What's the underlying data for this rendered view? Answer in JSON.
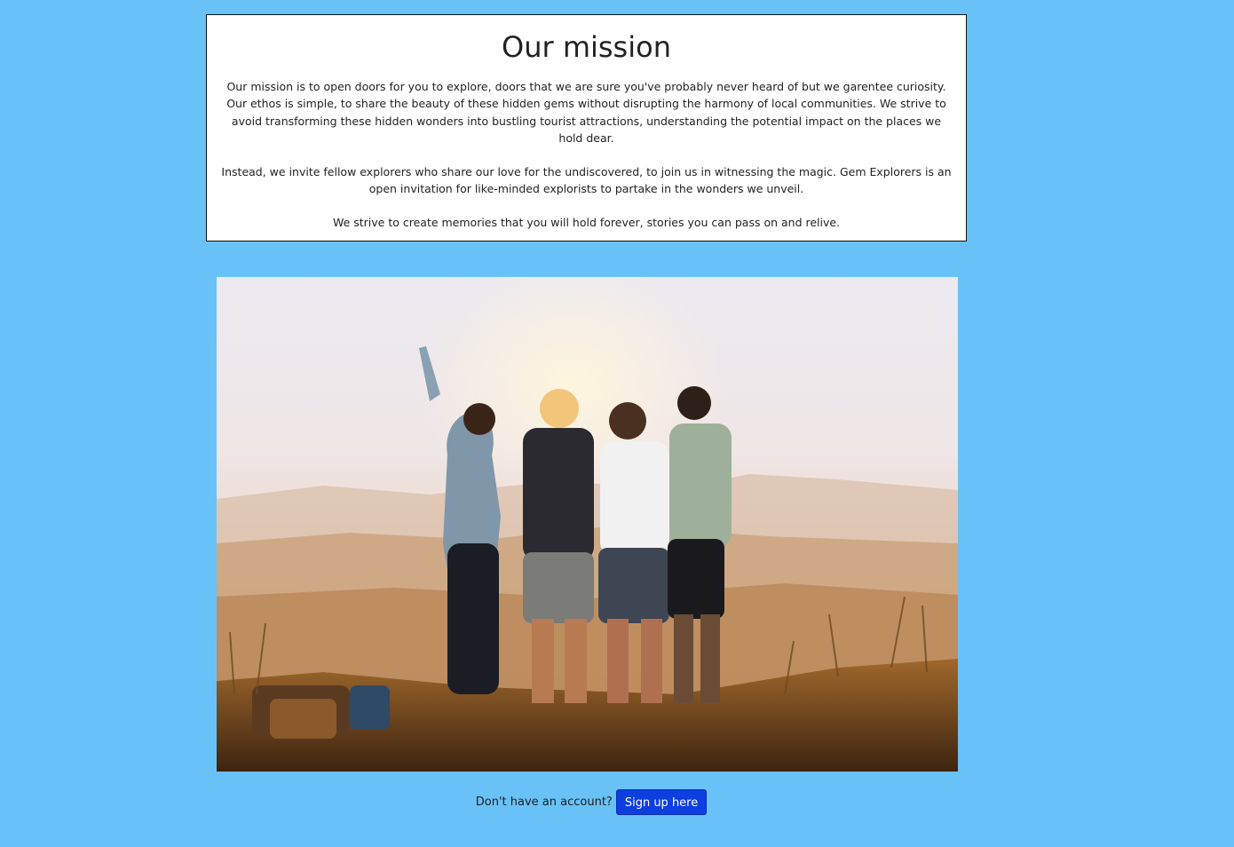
{
  "mission": {
    "title": "Our mission",
    "paragraphs": [
      "Our mission is to open doors for you to explore, doors that we are sure you've probably never heard of but we garentee curiosity. Our ethos is simple, to share the beauty of these hidden gems without disrupting the harmony of local communities. We strive to avoid transforming these hidden wonders into bustling tourist attractions, understanding the potential impact on the places we hold dear.",
      "Instead, we invite fellow explorers who share our love for the undiscovered, to join us in witnessing the magic. Gem Explorers is an open invitation for like-minded explorists to partake in the wonders we unveil.",
      "We strive to create memories that you will hold forever, stories you can pass on and relive."
    ]
  },
  "signup": {
    "prompt": "Don't have an account?",
    "button_label": "Sign up here"
  },
  "colors": {
    "page_background": "#69c2f7",
    "button_background": "#0d3ee0"
  }
}
